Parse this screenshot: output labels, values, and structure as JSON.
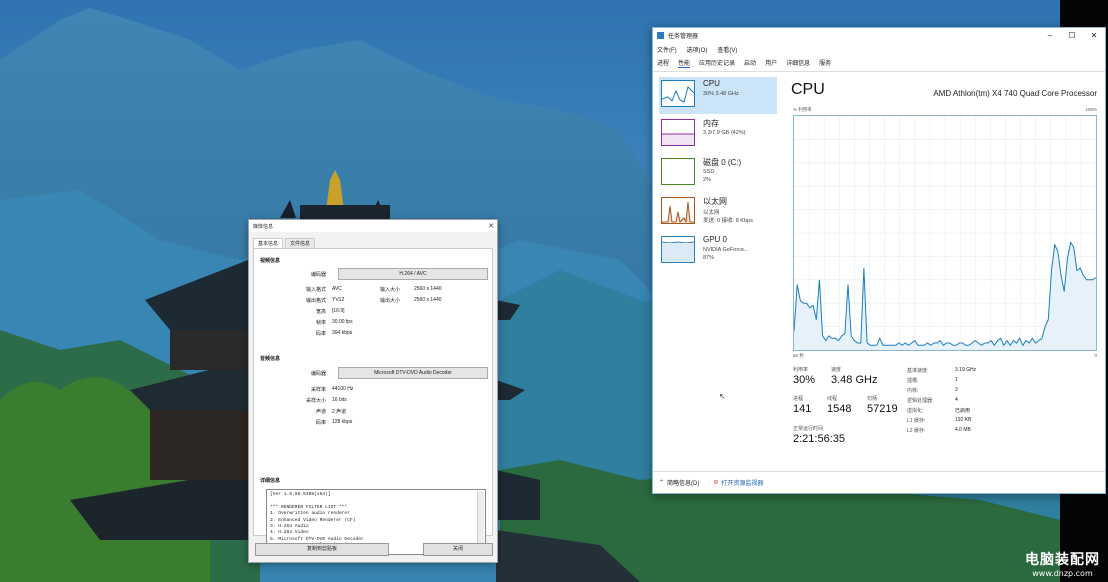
{
  "desktop": {
    "watermark_title": "电脑装配网",
    "watermark_url": "www.dnzp.com"
  },
  "media_info": {
    "title": "媒体信息",
    "tabs": [
      "基本信息",
      "文件信息"
    ],
    "video_section": "视频信息",
    "video_codec_label": "编码器",
    "video_codec": "H.264 / AVC",
    "video_rows": [
      {
        "l1": "输入格式",
        "v1": "AVC",
        "l2": "输入大小",
        "v2": "2560 x 1440"
      },
      {
        "l1": "输出格式",
        "v1": "YV12",
        "l2": "输出大小",
        "v2": "2560 x 1440"
      }
    ],
    "video_rows2": [
      {
        "label": "宽高",
        "value": "[16:9]"
      },
      {
        "label": "帧率",
        "value": "30.00 fps"
      },
      {
        "label": "码率",
        "value": "394 kbps"
      }
    ],
    "audio_section": "音频信息",
    "audio_codec_label": "编码器",
    "audio_codec": "Microsoft DTV-DVD Audio Decoder",
    "audio_rows": [
      {
        "label": "采样率",
        "value": "44100 Hz"
      },
      {
        "label": "采样大小",
        "value": "16 bits"
      },
      {
        "label": "声道",
        "value": "2 声道"
      },
      {
        "label": "码率",
        "value": "128 kbps"
      }
    ],
    "detail_section": "详细信息",
    "log_lines": [
      "[Ver 1.5.96.5308(x64)]",
      "",
      "*** RENDERER FILTER LIST ***",
      "1. Overwritten audio renderer",
      "2. Enhanced Video Renderer (CF)",
      "3. H.264 Audio",
      "4. H.264 Video",
      "5. Microsoft DTV-DVD Audio Decoder",
      "6. H.264 Source Filter (mp4)"
    ],
    "copy_button": "复制到剪贴板",
    "close_button": "关闭"
  },
  "task_manager": {
    "title": "任务管理器",
    "menu": [
      "文件(F)",
      "选项(O)",
      "查看(V)"
    ],
    "tabs": [
      "进程",
      "性能",
      "应用历史记录",
      "启动",
      "用户",
      "详细信息",
      "服务"
    ],
    "active_tab": "性能",
    "sidebar": [
      {
        "name": "CPU",
        "line1": "30%  3.48 GHz",
        "line2": ""
      },
      {
        "name": "内存",
        "line1": "3.3/7.9 GB (42%)",
        "line2": ""
      },
      {
        "name": "磁盘 0 (C:)",
        "line1": "SSD",
        "line2": "2%"
      },
      {
        "name": "以太网",
        "line1": "以太网",
        "line2": "发送: 0  接收: 8 Kbps"
      },
      {
        "name": "GPU 0",
        "line1": "NVIDIA GeForce...",
        "line2": "87%"
      }
    ],
    "main_title": "CPU",
    "cpu_model": "AMD Athlon(tm) X4 740 Quad Core Processor",
    "graph_label": "% 利用率",
    "graph_max": "100%",
    "graph_span": "60 秒",
    "graph_min": "0",
    "stats": {
      "util_label": "利用率",
      "util": "30%",
      "speed_label": "速度",
      "speed": "3.48 GHz",
      "proc_label": "进程",
      "proc": "141",
      "thread_label": "线程",
      "thread": "1548",
      "handle_label": "句柄",
      "handle": "57219",
      "uptime_label": "正常运行时间",
      "uptime": "2:21:56:35"
    },
    "info": [
      {
        "k": "基准速度:",
        "v": "3.19 GHz"
      },
      {
        "k": "插槽:",
        "v": "1"
      },
      {
        "k": "内核:",
        "v": "2"
      },
      {
        "k": "逻辑处理器:",
        "v": "4"
      },
      {
        "k": "虚拟化:",
        "v": "已启用"
      },
      {
        "k": "L1 缓存:",
        "v": "192 KB"
      },
      {
        "k": "L2 缓存:",
        "v": "4.0 MB"
      }
    ],
    "footer_less": "简略信息(D)",
    "footer_monitor": "打开资源监视器",
    "colors": {
      "cpu": "#1a7fbf",
      "memory": "#8b2fa0",
      "disk": "#4d8a1e",
      "ethernet": "#a8541c",
      "gpu": "#2c7fb8"
    },
    "cpu_history": [
      8,
      28,
      21,
      20,
      20,
      18,
      19,
      13,
      30,
      6,
      4,
      6,
      5,
      5,
      4,
      6,
      7,
      28,
      6,
      4,
      3,
      3,
      35,
      3,
      2,
      2,
      2,
      5,
      2,
      2,
      2,
      2,
      2,
      3,
      2,
      3,
      2,
      3,
      4,
      2,
      2,
      2,
      3,
      2,
      3,
      3,
      4,
      2,
      3,
      3,
      2,
      2,
      3,
      3,
      2,
      2,
      3,
      4,
      3,
      2,
      3,
      3,
      4,
      2,
      4,
      5,
      2,
      4,
      2,
      4,
      3,
      5,
      2,
      4,
      3,
      5,
      3,
      4,
      5,
      10,
      13,
      34,
      45,
      42,
      32,
      25,
      39,
      46,
      44,
      34,
      35,
      32,
      30,
      30,
      30,
      31
    ]
  }
}
